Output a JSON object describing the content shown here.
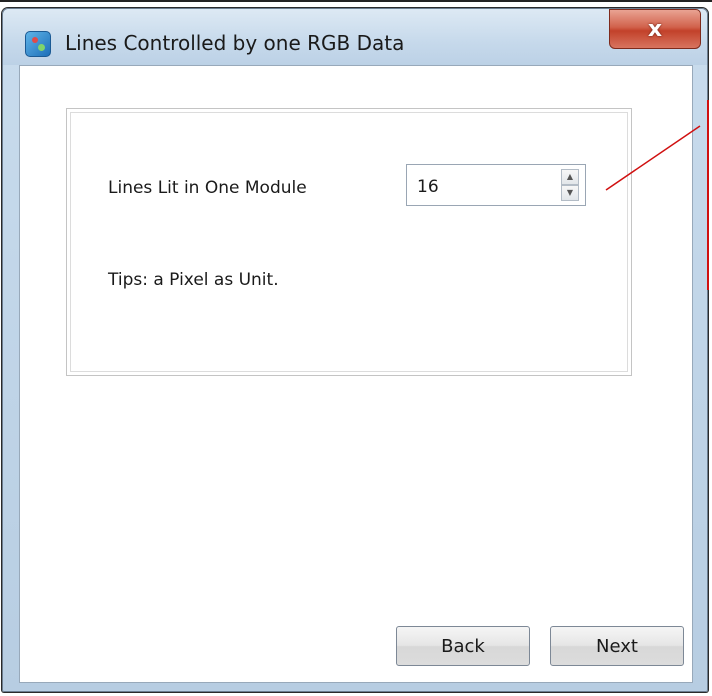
{
  "window": {
    "title": "Lines Controlled by one RGB Data",
    "close_glyph": "x"
  },
  "form": {
    "lines_label": "Lines Lit in One Module",
    "lines_value": "16",
    "tips": "Tips: a Pixel as Unit."
  },
  "buttons": {
    "back": "Back",
    "next": "Next"
  },
  "icons": {
    "app": "app-icon",
    "close": "close-icon",
    "spin_up": "spin-up-icon",
    "spin_down": "spin-down-icon"
  },
  "colors": {
    "title_bar": "#c6d9eb",
    "close_button": "#c2412a",
    "annotation_line": "#d01010"
  }
}
